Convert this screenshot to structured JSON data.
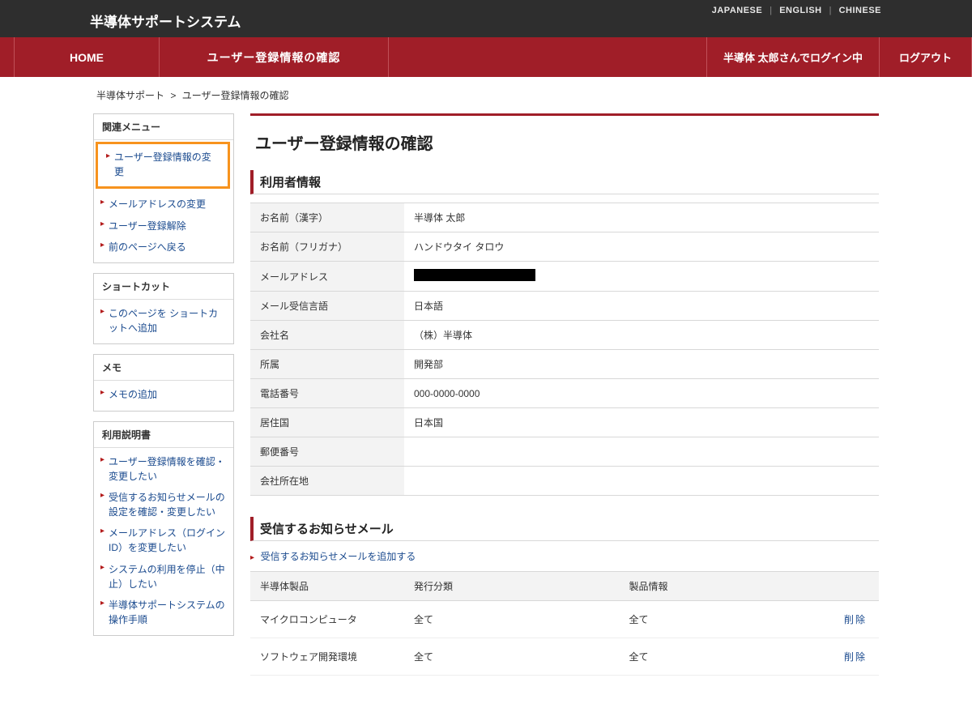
{
  "header": {
    "system_title": "半導体サポートシステム",
    "lang": {
      "japanese": "JAPANESE",
      "english": "ENGLISH",
      "chinese": "CHINESE"
    }
  },
  "nav": {
    "home": "HOME",
    "current": "ユーザー登録情報の確認",
    "login_info": "半導体 太郎さんでログイン中",
    "logout": "ログアウト"
  },
  "breadcrumb": {
    "semi_support": "半導体サポート",
    "current": "ユーザー登録情報の確認"
  },
  "sidebar": {
    "related": {
      "title": "関連メニュー",
      "items": [
        "ユーザー登録情報の変更",
        "メールアドレスの変更",
        "ユーザー登録解除",
        "前のページへ戻る"
      ]
    },
    "shortcuts": {
      "title": "ショートカット",
      "items": [
        "このページを ショートカットへ追加"
      ]
    },
    "memo": {
      "title": "メモ",
      "items": [
        "メモの追加"
      ]
    },
    "docs": {
      "title": "利用説明書",
      "items": [
        "ユーザー登録情報を確認・変更したい",
        "受信するお知らせメールの設定を確認・変更したい",
        "メールアドレス（ログインID）を変更したい",
        "システムの利用を停止（中止）したい",
        "半導体サポートシステムの操作手順"
      ]
    }
  },
  "main": {
    "page_title": "ユーザー登録情報の確認",
    "user_info_head": "利用者情報",
    "user_info": {
      "name_kanji_label": "お名前（漢字）",
      "name_kanji": "半導体 太郎",
      "name_kana_label": "お名前（フリガナ）",
      "name_kana": "ハンドウタイ タロウ",
      "email_label": "メールアドレス",
      "mail_lang_label": "メール受信言語",
      "mail_lang": "日本語",
      "company_label": "会社名",
      "company": "（株）半導体",
      "dept_label": "所属",
      "dept": "開発部",
      "phone_label": "電話番号",
      "phone": "000-0000-0000",
      "country_label": "居住国",
      "country": "日本国",
      "postal_label": "郵便番号",
      "postal": "",
      "address_label": "会社所在地",
      "address": ""
    },
    "notify": {
      "head": "受信するお知らせメール",
      "add_link": "受信するお知らせメールを追加する",
      "col_product": "半導体製品",
      "col_pubtype": "発行分類",
      "col_prodinfo": "製品情報",
      "delete_label": "削除",
      "rows": [
        {
          "product": "マイクロコンピュータ",
          "pubtype": "全て",
          "prodinfo": "全て"
        },
        {
          "product": "ソフトウェア開発環境",
          "pubtype": "全て",
          "prodinfo": "全て"
        }
      ]
    }
  }
}
